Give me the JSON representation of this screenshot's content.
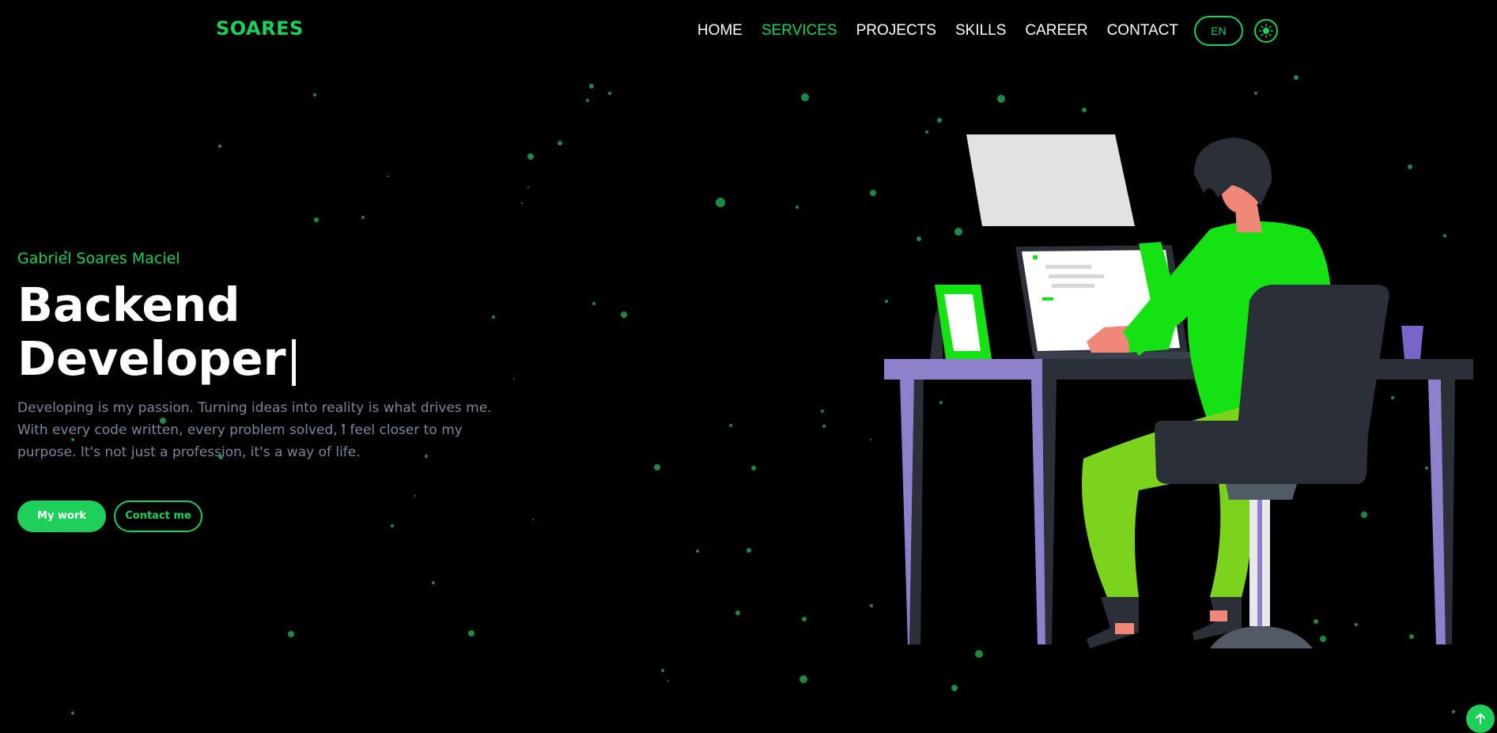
{
  "brand": {
    "logo": "SOARES"
  },
  "nav": {
    "items": [
      {
        "label": "HOME"
      },
      {
        "label": "SERVICES"
      },
      {
        "label": "PROJECTS"
      },
      {
        "label": "SKILLS"
      },
      {
        "label": "CAREER"
      },
      {
        "label": "CONTACT"
      }
    ],
    "active_item": "SERVICES",
    "language_button": "EN",
    "theme_toggle_icon": "sun-icon"
  },
  "hero": {
    "name": "Gabriel Soares Maciel",
    "title": "Backend Developer",
    "cursor": "|",
    "description": "Developing is my passion. Turning ideas into reality is what drives me. With every code written, every problem solved, I feel closer to my purpose. It's not just a profession, it's a way of life.",
    "primary_button": "My work",
    "secondary_button": "Contact me"
  },
  "scroll_top": {
    "icon": "arrow-up-icon"
  },
  "colors": {
    "background": "#000000",
    "accent": "#1ecf5a",
    "text": "#ffffff",
    "muted_text": "#7e849c",
    "particles": "#1a8a45"
  }
}
